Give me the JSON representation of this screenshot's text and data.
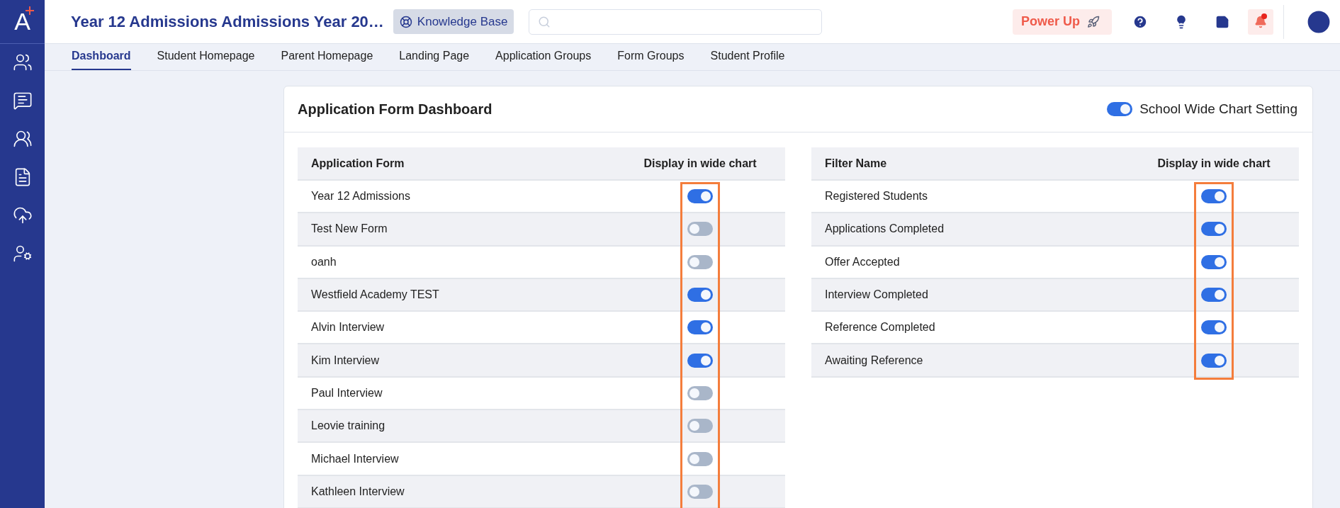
{
  "logo": {
    "letter": "A"
  },
  "header": {
    "title": "Year 12 Admissions Admissions Year 20…",
    "knowledge_base": "Knowledge Base",
    "power_up": "Power Up",
    "notifications": {
      "unread": true
    }
  },
  "tabs": [
    {
      "label": "Dashboard",
      "selected": true
    },
    {
      "label": "Student Homepage",
      "selected": false
    },
    {
      "label": "Parent Homepage",
      "selected": false
    },
    {
      "label": "Landing Page",
      "selected": false
    },
    {
      "label": "Application Groups",
      "selected": false
    },
    {
      "label": "Form Groups",
      "selected": false
    },
    {
      "label": "Student Profile",
      "selected": false
    }
  ],
  "card": {
    "title": "Application Form Dashboard",
    "school_wide": {
      "label": "School Wide Chart Setting",
      "on": true
    }
  },
  "tables": [
    {
      "columns": [
        "Application Form",
        "Display in wide chart"
      ],
      "highlighted": true,
      "rows": [
        {
          "name": "Year 12 Admissions",
          "on": true
        },
        {
          "name": "Test New Form",
          "on": false
        },
        {
          "name": "oanh",
          "on": false
        },
        {
          "name": "Westfield Academy TEST",
          "on": true
        },
        {
          "name": "Alvin Interview",
          "on": true
        },
        {
          "name": "Kim Interview",
          "on": true
        },
        {
          "name": "Paul Interview",
          "on": false
        },
        {
          "name": "Leovie training",
          "on": false
        },
        {
          "name": "Michael Interview",
          "on": false
        },
        {
          "name": "Kathleen Interview",
          "on": false
        }
      ]
    },
    {
      "columns": [
        "Filter Name",
        "Display in wide chart"
      ],
      "highlighted": true,
      "rows": [
        {
          "name": "Registered Students",
          "on": true
        },
        {
          "name": "Applications Completed",
          "on": true
        },
        {
          "name": "Offer Accepted",
          "on": true
        },
        {
          "name": "Interview Completed",
          "on": true
        },
        {
          "name": "Reference Completed",
          "on": true
        },
        {
          "name": "Awaiting Reference",
          "on": true
        }
      ]
    }
  ]
}
